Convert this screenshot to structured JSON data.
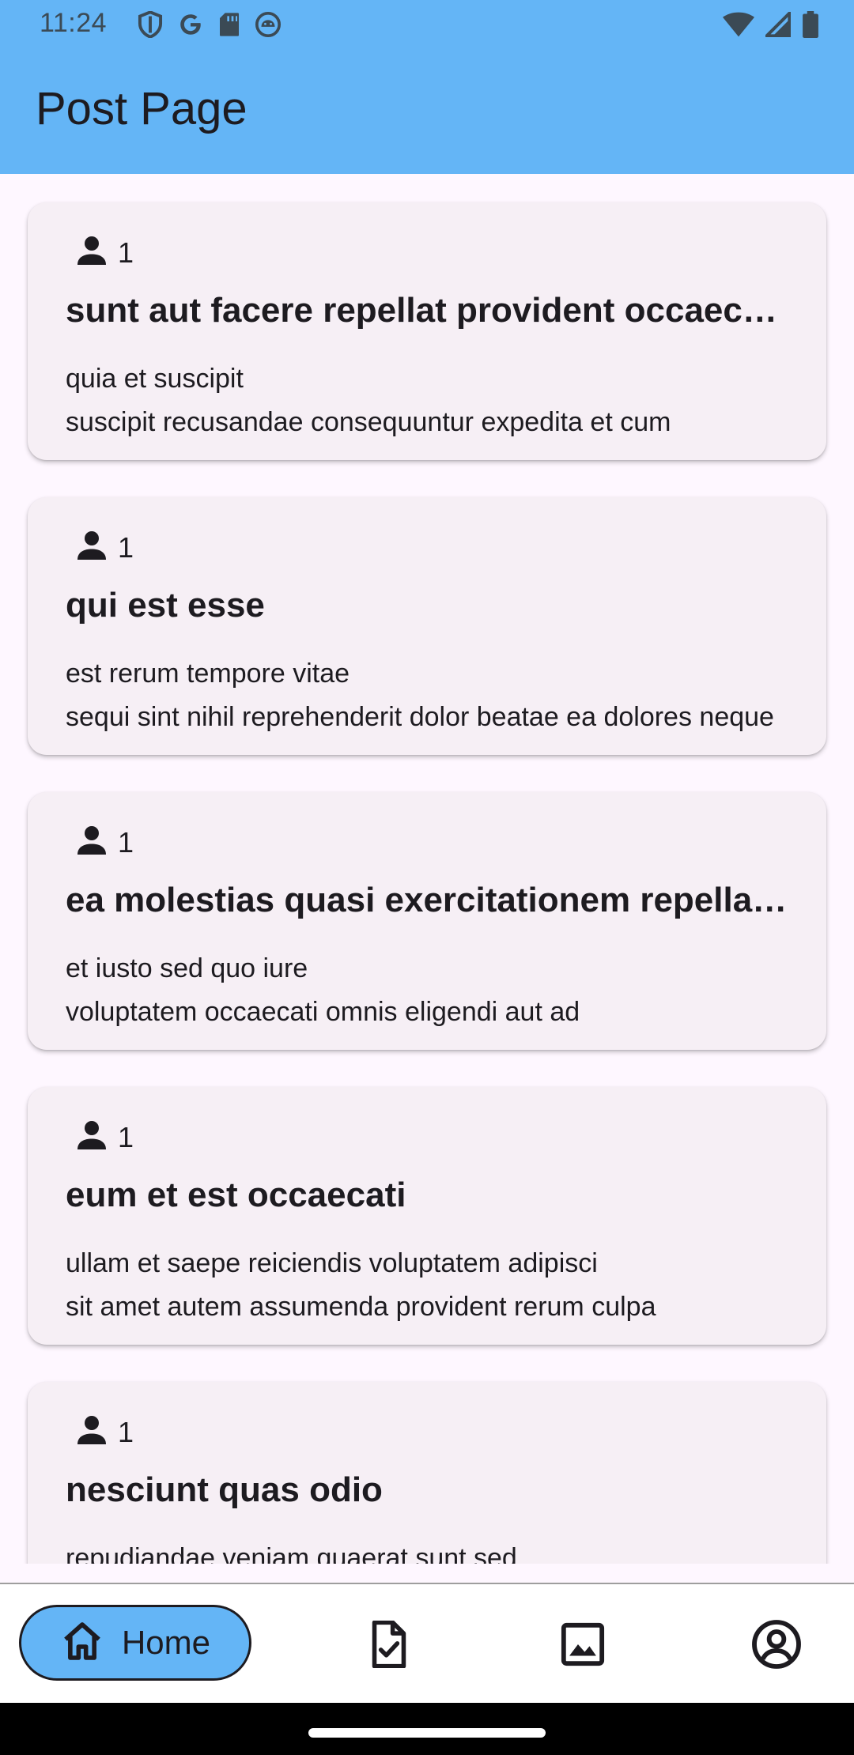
{
  "status_bar": {
    "time": "11:24",
    "left_icons": [
      "shield-icon",
      "google-icon",
      "sd-card-icon",
      "android-icon"
    ],
    "right_icons": [
      "wifi-icon",
      "signal-icon",
      "battery-icon"
    ]
  },
  "app_bar": {
    "title": "Post Page",
    "color": "#64B5F6"
  },
  "posts": [
    {
      "user_id": "1",
      "title": "sunt aut facere repellat provident occaecati excepturi optio reprehenderit",
      "body_line1": "quia et suscipit",
      "body_line2": "suscipit recusandae consequuntur expedita et cum"
    },
    {
      "user_id": "1",
      "title": "qui est esse",
      "body_line1": "est rerum tempore vitae",
      "body_line2": "sequi sint nihil reprehenderit dolor beatae ea dolores neque"
    },
    {
      "user_id": "1",
      "title": "ea molestias quasi exercitationem repellat qui ipsa sit aut",
      "body_line1": "et iusto sed quo iure",
      "body_line2": "voluptatem occaecati omnis eligendi aut ad"
    },
    {
      "user_id": "1",
      "title": "eum et est occaecati",
      "body_line1": "ullam et saepe reiciendis voluptatem adipisci",
      "body_line2": "sit amet autem assumenda provident rerum culpa"
    },
    {
      "user_id": "1",
      "title": "nesciunt quas odio",
      "body_line1": "repudiandae veniam quaerat sunt sed",
      "body_line2": ""
    }
  ],
  "bottom_nav": {
    "items": [
      {
        "label": "Home",
        "icon": "home-icon",
        "selected": true
      },
      {
        "label": "",
        "icon": "task-icon",
        "selected": false
      },
      {
        "label": "",
        "icon": "image-icon",
        "selected": false
      },
      {
        "label": "",
        "icon": "account-icon",
        "selected": false
      }
    ]
  }
}
